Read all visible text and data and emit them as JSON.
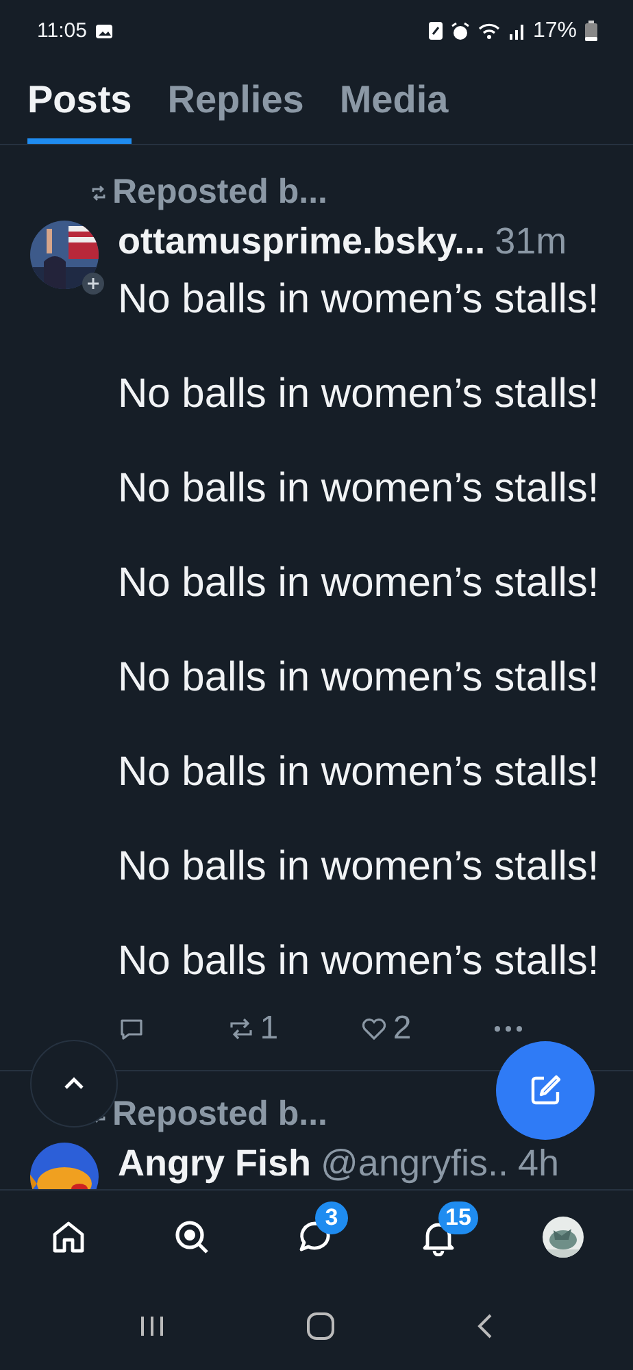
{
  "status_bar": {
    "time": "11:05",
    "battery": "17%"
  },
  "tabs": [
    {
      "label": "Posts",
      "selected": true
    },
    {
      "label": "Replies",
      "selected": false
    },
    {
      "label": "Media",
      "selected": false
    }
  ],
  "posts": [
    {
      "repost_label": "Reposted b...",
      "author": "ottamusprime.bsky...",
      "time": "31m",
      "follow_badge": true,
      "paragraphs": [
        "No balls in women’s stalls!",
        "No balls in women’s stalls!",
        "No balls in women’s stalls!",
        "No balls in women’s stalls!",
        "No balls in women’s stalls!",
        "No balls in women’s stalls!",
        "No balls in women’s stalls!",
        "No balls in women’s stalls!"
      ],
      "repost_count": "1",
      "like_count": "2"
    },
    {
      "repost_label": "Reposted b...",
      "author": "Angry Fish",
      "handle": "@angryfis..",
      "time": "4h"
    }
  ],
  "nav": [
    {
      "kind": "home"
    },
    {
      "kind": "search"
    },
    {
      "kind": "chat",
      "badge": "3"
    },
    {
      "kind": "bell",
      "badge": "15"
    },
    {
      "kind": "avatar"
    }
  ]
}
